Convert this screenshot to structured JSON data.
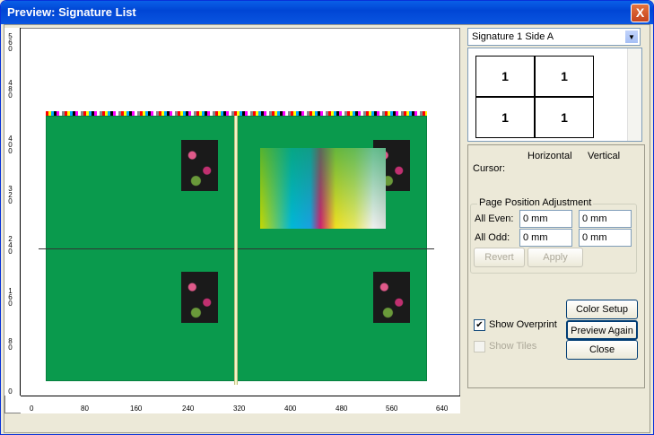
{
  "window": {
    "title": "Preview: Signature List",
    "close_glyph": "X"
  },
  "rulers": {
    "horizontal": [
      "0",
      "80",
      "160",
      "240",
      "320",
      "400",
      "480",
      "560",
      "640"
    ],
    "vertical": [
      "5 6 0",
      "4 8 0",
      "4 0 0",
      "3 2 0",
      "2 4 0",
      "1 6 0",
      "8 0",
      "0"
    ]
  },
  "panel": {
    "side_select": "Signature 1 Side A",
    "thumb_cells": [
      "1",
      "1",
      "1",
      "1"
    ],
    "horizontal_label": "Horizontal",
    "vertical_label": "Vertical",
    "cursor_label": "Cursor:",
    "group_title": "Page Position Adjustment",
    "all_even_label": "All Even:",
    "all_odd_label": "All Odd:",
    "even_h": "0 mm",
    "even_v": "0 mm",
    "odd_h": "0 mm",
    "odd_v": "0 mm",
    "revert": "Revert",
    "apply": "Apply",
    "show_overprint": "Show Overprint",
    "show_tiles": "Show Tiles",
    "color_setup": "Color Setup",
    "preview_again": "Preview Again",
    "close": "Close",
    "check_mark": "✔"
  }
}
